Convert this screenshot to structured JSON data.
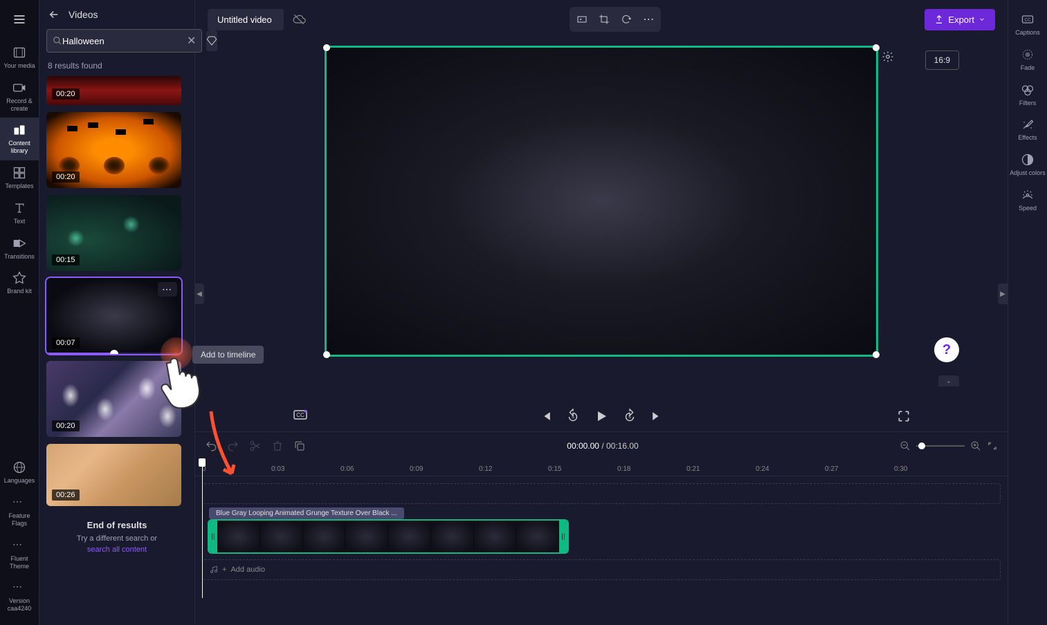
{
  "leftNav": {
    "items": [
      {
        "label": "Your media",
        "icon": "film"
      },
      {
        "label": "Record & create",
        "icon": "camera"
      },
      {
        "label": "Content library",
        "icon": "library",
        "active": true
      },
      {
        "label": "Templates",
        "icon": "grid"
      },
      {
        "label": "Text",
        "icon": "text"
      },
      {
        "label": "Transitions",
        "icon": "transitions"
      },
      {
        "label": "Brand kit",
        "icon": "brand"
      }
    ],
    "bottomItems": [
      {
        "label": "Languages",
        "icon": "globe"
      },
      {
        "label": "Feature Flags",
        "icon": "dots"
      },
      {
        "label": "Fluent Theme",
        "icon": "dots"
      },
      {
        "label": "Version caa4240",
        "icon": "dots"
      }
    ]
  },
  "contentPanel": {
    "title": "Videos",
    "searchValue": "Halloween",
    "resultsCount": "8 results found",
    "videos": [
      {
        "duration": "00:20",
        "short": true
      },
      {
        "duration": "00:20"
      },
      {
        "duration": "00:15"
      },
      {
        "duration": "00:07",
        "selected": true,
        "showMore": true
      },
      {
        "duration": "00:20"
      },
      {
        "duration": "00:26"
      }
    ],
    "endTitle": "End of results",
    "endSub": "Try a different search or",
    "endLink": "search all content"
  },
  "tooltip": "Add to timeline",
  "topBar": {
    "title": "Untitled video",
    "exportLabel": "Export"
  },
  "aspectRatio": "16:9",
  "timecode": {
    "current": "00:00.00",
    "total": "00:16.00"
  },
  "rulerMarks": [
    "0",
    "0:03",
    "0:06",
    "0:09",
    "0:12",
    "0:15",
    "0:18",
    "0:21",
    "0:24",
    "0:27",
    "0:30"
  ],
  "clipTitle": "Blue Gray Looping Animated Grunge Texture Over Black ...",
  "audioTrackLabel": "Add audio",
  "rightNav": {
    "items": [
      {
        "label": "Captions",
        "icon": "cc"
      },
      {
        "label": "Fade",
        "icon": "fade"
      },
      {
        "label": "Filters",
        "icon": "filters"
      },
      {
        "label": "Effects",
        "icon": "effects"
      },
      {
        "label": "Adjust colors",
        "icon": "adjust"
      },
      {
        "label": "Speed",
        "icon": "speed"
      }
    ]
  }
}
